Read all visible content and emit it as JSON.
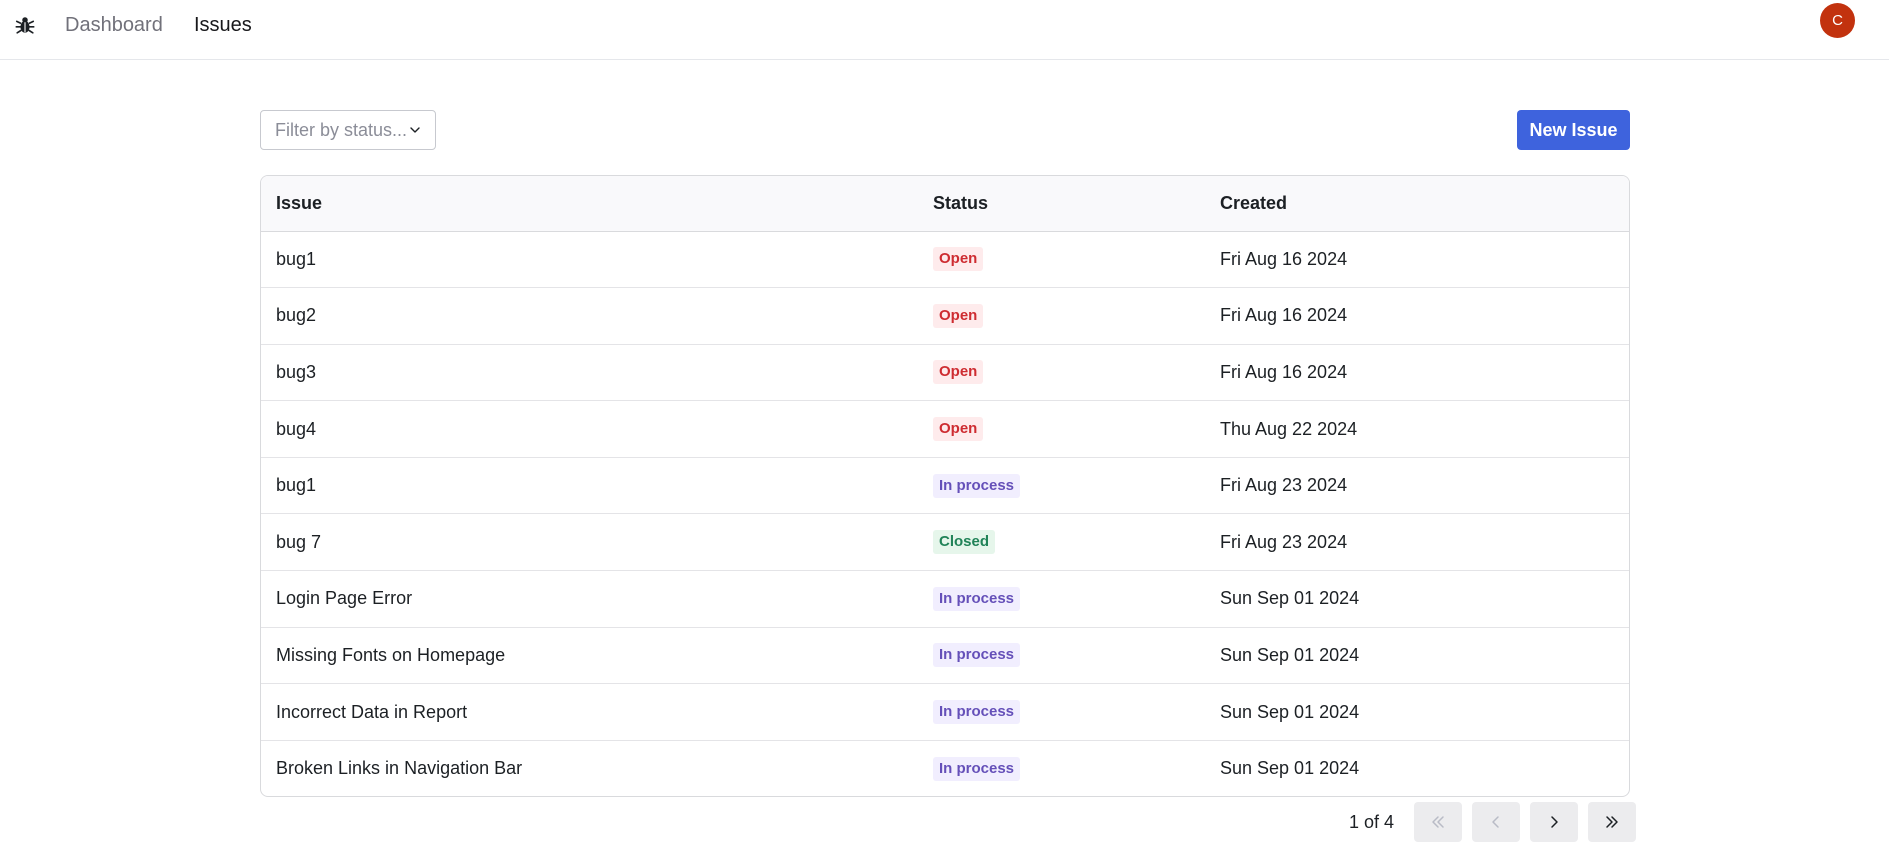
{
  "nav": {
    "logo_icon": "bug-icon",
    "links": [
      {
        "label": "Dashboard"
      },
      {
        "label": "Issues"
      }
    ],
    "avatar_initial": "C",
    "avatar_color": "#c2320e"
  },
  "toolbar": {
    "filter_placeholder": "Filter by status...",
    "new_issue_label": "New Issue",
    "accent_color": "#3e63dd"
  },
  "table": {
    "headers": [
      "Issue",
      "Status",
      "Created"
    ],
    "rows": [
      {
        "title": "bug1",
        "status": "Open",
        "created": "Fri Aug 16 2024"
      },
      {
        "title": "bug2",
        "status": "Open",
        "created": "Fri Aug 16 2024"
      },
      {
        "title": "bug3",
        "status": "Open",
        "created": "Fri Aug 16 2024"
      },
      {
        "title": "bug4",
        "status": "Open",
        "created": "Thu Aug 22 2024"
      },
      {
        "title": "bug1",
        "status": "In process",
        "created": "Fri Aug 23 2024"
      },
      {
        "title": "bug 7",
        "status": "Closed",
        "created": "Fri Aug 23 2024"
      },
      {
        "title": "Login Page Error",
        "status": "In process",
        "created": "Sun Sep 01 2024"
      },
      {
        "title": "Missing Fonts on Homepage",
        "status": "In process",
        "created": "Sun Sep 01 2024"
      },
      {
        "title": "Incorrect Data in Report",
        "status": "In process",
        "created": "Sun Sep 01 2024"
      },
      {
        "title": "Broken Links in Navigation Bar",
        "status": "In process",
        "created": "Sun Sep 01 2024"
      }
    ]
  },
  "status_colors": {
    "Open": "#ce2c31",
    "In process": "#6550b9",
    "Closed": "#218358"
  },
  "pagination": {
    "label": "1 of 4",
    "current_page": 1,
    "total_pages": 4,
    "buttons": [
      "chevrons-left-icon",
      "chevron-left-icon",
      "chevron-right-icon",
      "chevrons-right-icon"
    ]
  }
}
